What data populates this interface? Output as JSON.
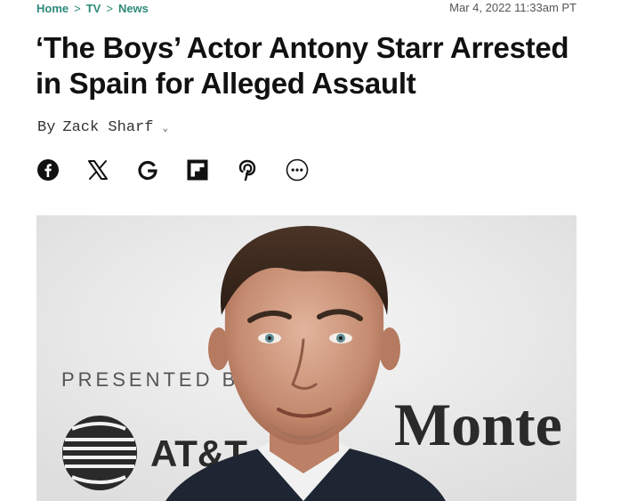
{
  "breadcrumb": {
    "items": [
      "Home",
      "TV",
      "News"
    ],
    "separator": ">"
  },
  "article": {
    "date": "Mar 4, 2022 11:33am PT",
    "title": "‘The Boys’ Actor Antony Starr Arrested in Spain for Alleged Assault",
    "byline_prefix": "By",
    "author": "Zack Sharf"
  },
  "share_icons": [
    "facebook-icon",
    "x-icon",
    "google-icon",
    "flipboard-icon",
    "pinterest-icon",
    "more-icon"
  ],
  "hero_image": {
    "backdrop_text_1": "PRESENTED B",
    "backdrop_text_2": "AT&T",
    "backdrop_text_3": "Monte"
  },
  "colors": {
    "accent": "#2d8a7a",
    "text": "#111111",
    "muted": "#555555"
  }
}
